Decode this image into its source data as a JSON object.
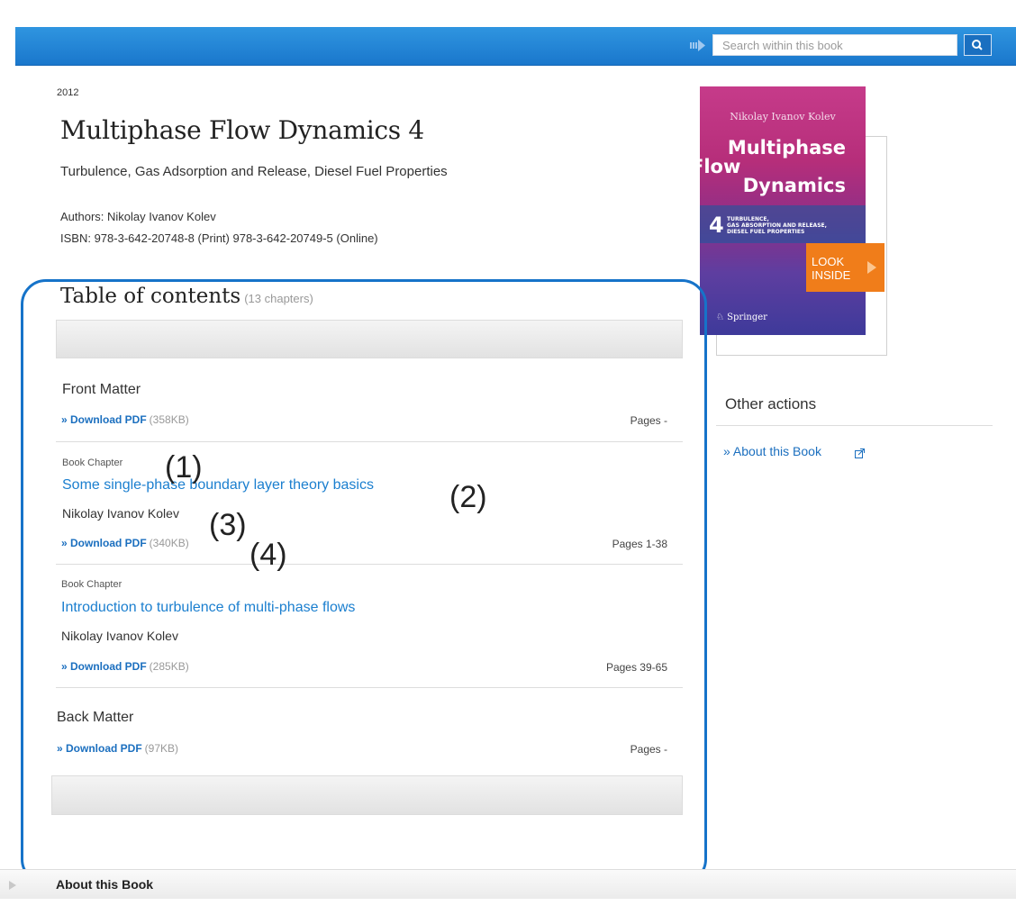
{
  "search": {
    "placeholder": "Search within this book"
  },
  "book": {
    "year": "2012",
    "title": "Multiphase Flow Dynamics 4",
    "subtitle": "Turbulence, Gas Adsorption and Release, Diesel Fuel Properties",
    "authors": "Authors: Nikolay Ivanov Kolev",
    "isbn": "ISBN: 978-3-642-20748-8 (Print) 978-3-642-20749-5 (Online)"
  },
  "cover": {
    "author": "Nikolay Ivanov Kolev",
    "title_line1": "Multiphase",
    "title_line2": "Flow",
    "title_line3": "Dynamics",
    "volume": "4",
    "subtitle_line1": "TURBULENCE,",
    "subtitle_line2": "GAS ABSORPTION AND RELEASE,",
    "subtitle_line3": "DIESEL FUEL PROPERTIES",
    "publisher": "Springer",
    "look_inside_line1": "LOOK",
    "look_inside_line2": "INSIDE"
  },
  "other_actions": {
    "title": "Other actions",
    "about_link": "» About this Book"
  },
  "toc": {
    "title": "Table of contents",
    "count": "(13 chapters)",
    "front_matter": {
      "heading": "Front Matter",
      "download": "» Download PDF",
      "size": "(358KB)",
      "pages": "Pages -"
    },
    "chapters": [
      {
        "type": "Book Chapter",
        "title": "Some single-phase boundary layer theory basics",
        "author": "Nikolay Ivanov Kolev",
        "download": "» Download PDF",
        "size": "(340KB)",
        "pages": "Pages 1-38"
      },
      {
        "type": "Book Chapter",
        "title": "Introduction to turbulence of multi-phase flows",
        "author": "Nikolay Ivanov Kolev",
        "download": "» Download PDF",
        "size": "(285KB)",
        "pages": "Pages 39-65"
      }
    ],
    "back_matter": {
      "heading": "Back Matter",
      "download": "» Download PDF",
      "size": "(97KB)",
      "pages": "Pages -"
    }
  },
  "callouts": [
    "(1)",
    "(2)",
    "(3)",
    "(4)"
  ],
  "about_bar": {
    "label": "About this Book"
  },
  "colors": {
    "link": "#1b6fbf",
    "topbar": "#1a77cc",
    "look_inside": "#f07d1a",
    "annotation_frame": "#1673c9"
  }
}
